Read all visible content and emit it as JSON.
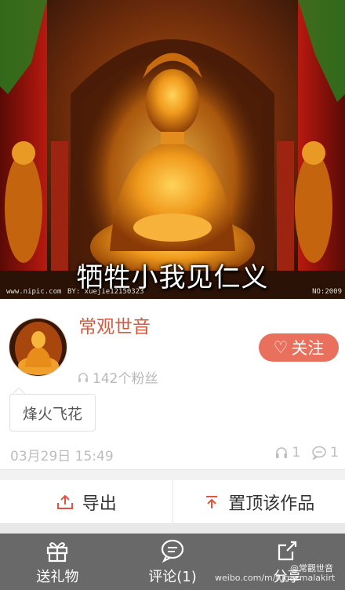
{
  "hero": {
    "caption": "牺牲小我见仁义",
    "watermark_left": "www.nipic.com",
    "watermark_right": "BY: xuejie12150323",
    "watermark_corner": "NO:2009"
  },
  "author": {
    "name": "常观世音",
    "follow_label": "关注",
    "fans_text": "142个粉丝"
  },
  "post": {
    "tag": "烽火飞花",
    "timestamp": "03月29日 15:49",
    "listen_count": "1",
    "comment_count": "1"
  },
  "actions": {
    "export_label": "导出",
    "pin_label": "置顶该作品"
  },
  "bottom_bar": {
    "gift_label": "送礼物",
    "comment_label": "评论(1)",
    "share_label": "分享"
  },
  "overlay_watermark": {
    "site": "weibo.com/m/fugazmalakirt",
    "handle": "@常觀世音"
  },
  "colors": {
    "accent": "#e8705d",
    "author_name": "#d15a3f",
    "bottom_bar": "#696969"
  }
}
